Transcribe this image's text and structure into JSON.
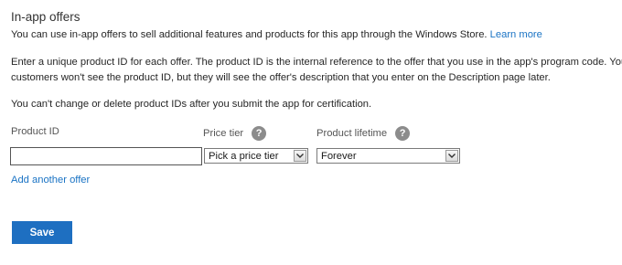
{
  "section": {
    "title": "In-app offers",
    "intro_text": "You can use in-app offers to sell additional features and products for this app through the Windows Store.",
    "learn_more_link": "Learn more",
    "instructions_line1": "Enter a unique product ID for each offer. The product ID is the internal reference to the offer that you use in the app's program code. Your",
    "instructions_line2": "customers won't see the product ID, but they will see the offer's description that you enter on the Description page later.",
    "warning_text": "You can't change or delete product IDs after you submit the app for certification."
  },
  "form": {
    "product_id_label": "Product ID",
    "product_id_value": "",
    "price_tier_label": "Price tier",
    "price_tier_selected": "Pick a price tier",
    "product_lifetime_label": "Product lifetime",
    "product_lifetime_selected": "Forever",
    "help_icon_glyph": "?",
    "add_another_offer": "Add another offer"
  },
  "actions": {
    "save_label": "Save"
  },
  "colors": {
    "link": "#1a73c4",
    "primary_button": "#1e6fc1",
    "help_icon": "#8c8c8c"
  }
}
